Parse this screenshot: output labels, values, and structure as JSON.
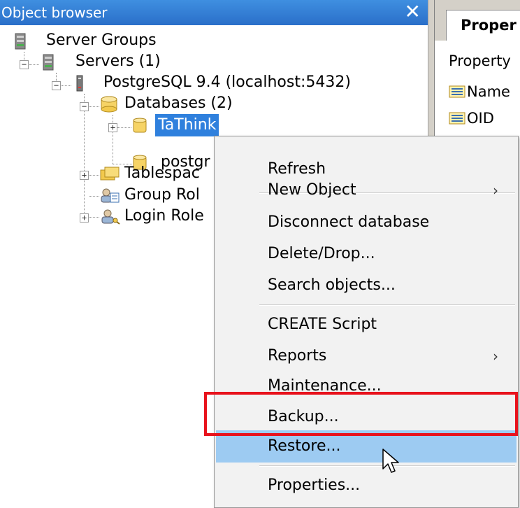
{
  "object_browser": {
    "title": "Object browser",
    "close_glyph": "✕",
    "tree": {
      "server_groups": "Server Groups",
      "servers": "Servers (1)",
      "server": "PostgreSQL 9.4 (localhost:5432)",
      "databases": "Databases (2)",
      "db_tathink": "TaThink",
      "db_postgres": "postgr",
      "tablespaces": "Tablespac",
      "group_roles": "Group Rol",
      "login_roles": "Login Role",
      "expand_plus": "+",
      "collapse_minus": "−"
    }
  },
  "properties_panel": {
    "tab_label": "Proper",
    "rows": [
      "Property",
      "Name",
      "OID"
    ]
  },
  "context_menu": {
    "items": {
      "refresh": "Refresh",
      "new_object": "New Object",
      "disconnect": "Disconnect database",
      "delete_drop": "Delete/Drop...",
      "search_objects": "Search objects...",
      "create_script": "CREATE Script",
      "reports": "Reports",
      "maintenance": "Maintenance...",
      "backup": "Backup...",
      "restore": "Restore...",
      "properties": "Properties..."
    },
    "submenu_arrow": "›",
    "hovered_item": "Restore...",
    "highlighted_item": "Backup..."
  },
  "colors": {
    "title_bar": "#2a6fc9",
    "selection": "#2f80dd",
    "menu_hover": "#9dcbf2",
    "highlight_box": "#e8121c"
  }
}
